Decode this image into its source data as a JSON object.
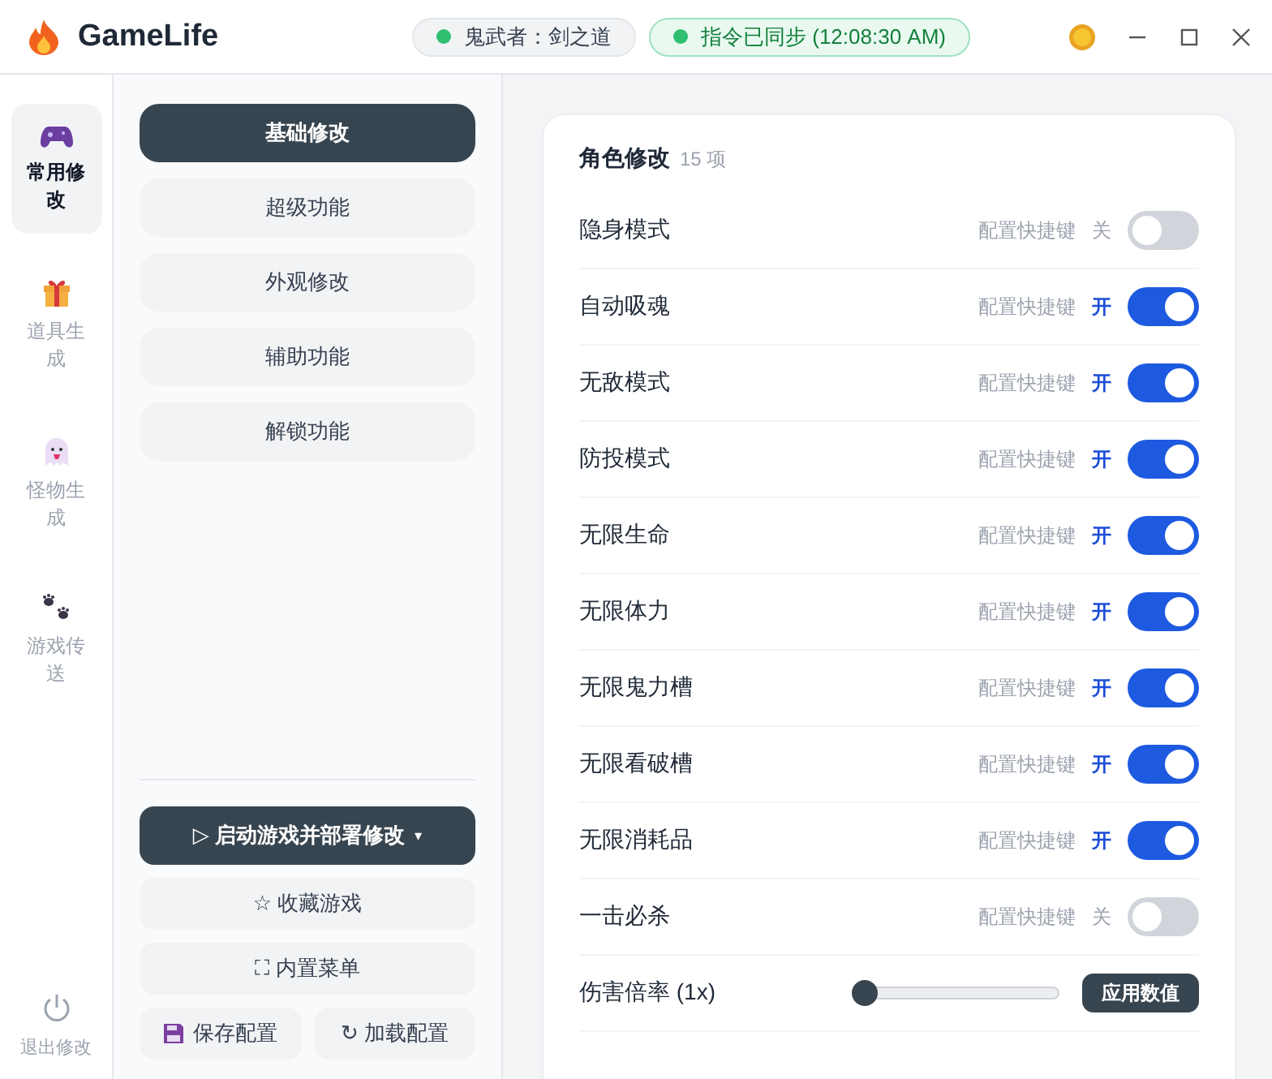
{
  "app": {
    "title": "GameLife"
  },
  "status_pills": [
    {
      "kind": "game",
      "text": "鬼武者：剑之道",
      "color": "#2fbf71"
    },
    {
      "kind": "sync",
      "text": "指令已同步 (12:08:30 AM)",
      "color": "#2fbf71"
    }
  ],
  "nav": [
    {
      "label": "常用修改",
      "kind": "gamepad",
      "selected": true
    },
    {
      "label": "道具生成",
      "kind": "gift",
      "selected": false
    },
    {
      "label": "怪物生成",
      "kind": "ghost",
      "selected": false
    },
    {
      "label": "游戏传送",
      "kind": "paw",
      "selected": false
    }
  ],
  "exit": {
    "label": "退出修改"
  },
  "categories": [
    {
      "label": "基础修改",
      "selected": true
    },
    {
      "label": "超级功能",
      "selected": false
    },
    {
      "label": "外观修改",
      "selected": false
    },
    {
      "label": "辅助功能",
      "selected": false
    },
    {
      "label": "解锁功能",
      "selected": false
    }
  ],
  "actions": {
    "launch": {
      "label": "▷ 启动游戏并部署修改",
      "caret": "▾"
    },
    "favorite": "☆ 收藏游戏",
    "menu": "⛶ 内置菜单",
    "save": "保存配置",
    "load": "↻ 加载配置"
  },
  "panel": {
    "title": "角色修改",
    "count": "15 项",
    "rows": [
      {
        "kind": "toggle",
        "label": "隐身模式",
        "hotkey": "配置快捷键",
        "state_text": "关",
        "on": false
      },
      {
        "kind": "toggle",
        "label": "自动吸魂",
        "hotkey": "配置快捷键",
        "state_text": "开",
        "on": true
      },
      {
        "kind": "toggle",
        "label": "无敌模式",
        "hotkey": "配置快捷键",
        "state_text": "开",
        "on": true
      },
      {
        "kind": "toggle",
        "label": "防投模式",
        "hotkey": "配置快捷键",
        "state_text": "开",
        "on": true
      },
      {
        "kind": "toggle",
        "label": "无限生命",
        "hotkey": "配置快捷键",
        "state_text": "开",
        "on": true
      },
      {
        "kind": "toggle",
        "label": "无限体力",
        "hotkey": "配置快捷键",
        "state_text": "开",
        "on": true
      },
      {
        "kind": "toggle",
        "label": "无限鬼力槽",
        "hotkey": "配置快捷键",
        "state_text": "开",
        "on": true
      },
      {
        "kind": "toggle",
        "label": "无限看破槽",
        "hotkey": "配置快捷键",
        "state_text": "开",
        "on": true
      },
      {
        "kind": "toggle",
        "label": "无限消耗品",
        "hotkey": "配置快捷键",
        "state_text": "开",
        "on": true
      },
      {
        "kind": "toggle",
        "label": "一击必杀",
        "hotkey": "配置快捷键",
        "state_text": "关",
        "on": false
      },
      {
        "kind": "slider",
        "label": "伤害倍率 (1x)",
        "level": 0,
        "button": "应用数值"
      }
    ]
  }
}
